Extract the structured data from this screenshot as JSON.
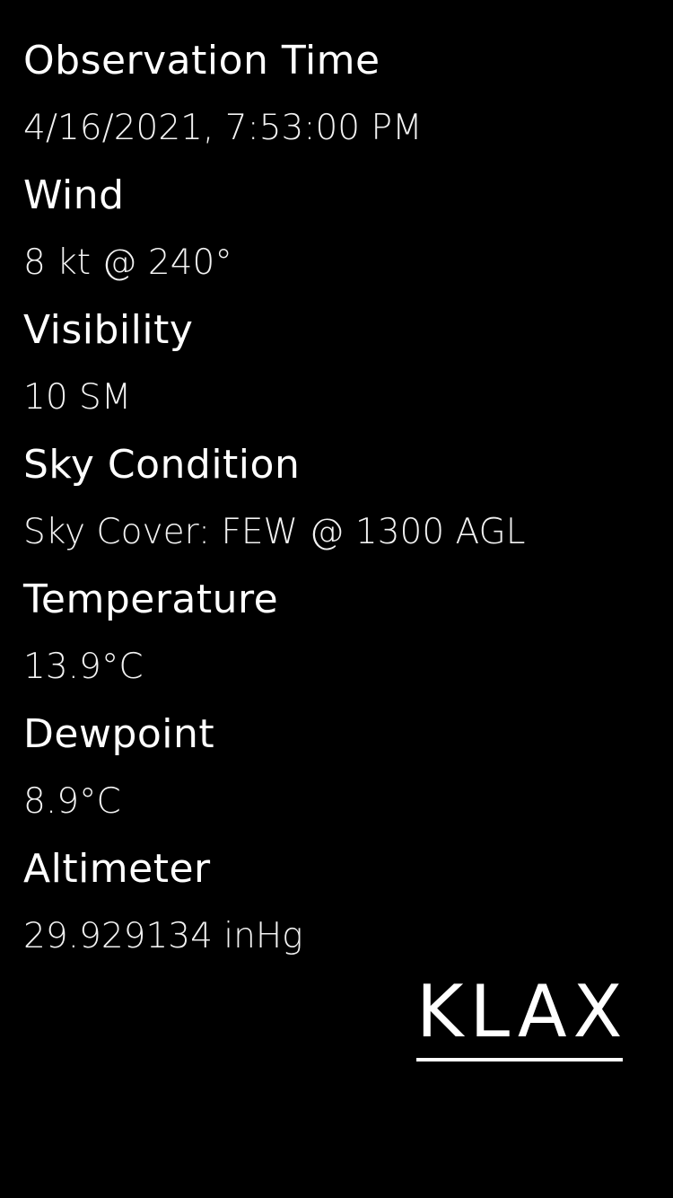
{
  "observations": [
    {
      "label": "Observation Time",
      "value": "4/16/2021, 7:53:00 PM"
    },
    {
      "label": "Wind",
      "value": "8 kt @ 240°"
    },
    {
      "label": "Visibility",
      "value": "10 SM"
    },
    {
      "label": "Sky Condition",
      "value": "Sky Cover: FEW @ 1300 AGL"
    },
    {
      "label": "Temperature",
      "value": "13.9°C"
    },
    {
      "label": "Dewpoint",
      "value": "8.9°C"
    },
    {
      "label": "Altimeter",
      "value": "29.929134 inHg"
    }
  ],
  "station": {
    "code": "KLAX"
  },
  "colors": {
    "background": "#000000",
    "text": "#ffffff"
  }
}
